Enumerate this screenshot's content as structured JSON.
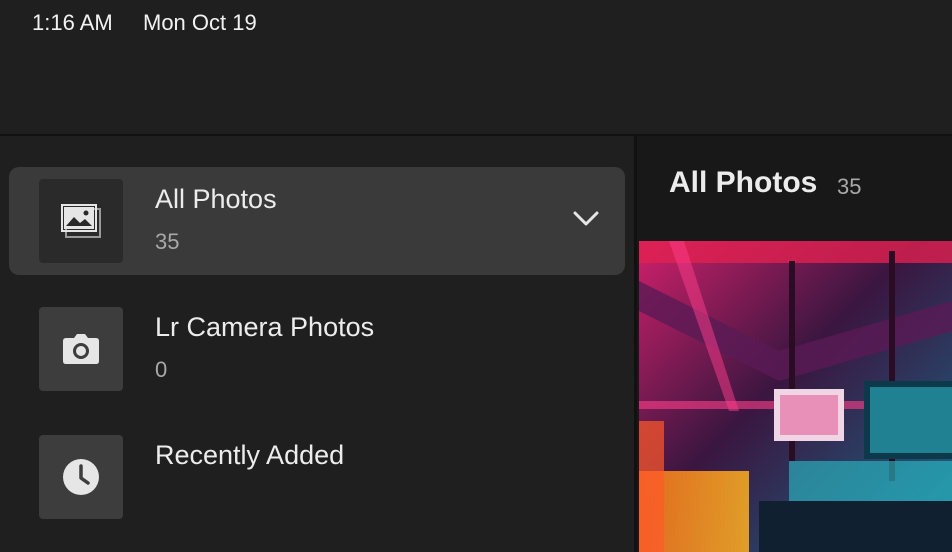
{
  "status": {
    "time": "1:16 AM",
    "date": "Mon Oct 19"
  },
  "albums": [
    {
      "title": "All Photos",
      "count": "35",
      "icon": "photos-icon"
    },
    {
      "title": "Lr Camera Photos",
      "count": "0",
      "icon": "camera-icon"
    },
    {
      "title": "Recently Added",
      "count": "",
      "icon": "clock-icon"
    }
  ],
  "main": {
    "title": "All Photos",
    "count": "35"
  },
  "colors": {
    "bg": "#1f1f1f",
    "selected": "#3a3a3a",
    "tile": "#3d3d3d"
  }
}
